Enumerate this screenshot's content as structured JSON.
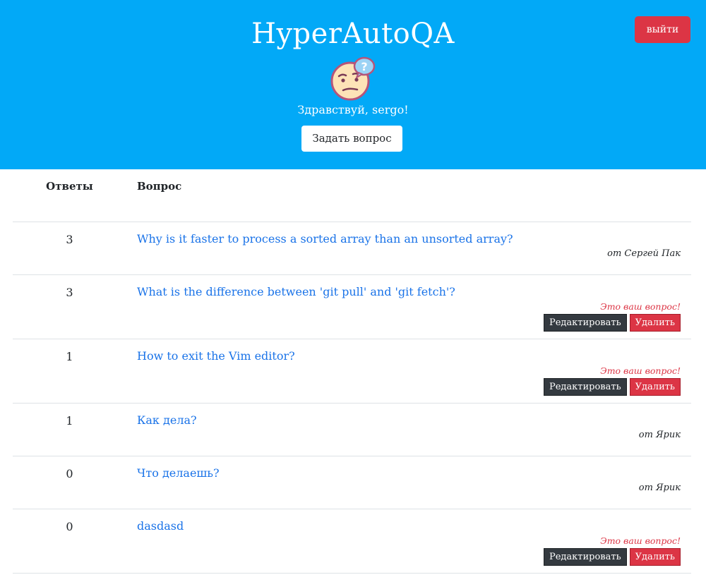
{
  "header": {
    "title": "HyperAutoQA",
    "logout_label": "выйти",
    "greeting": "Здравствуй, sergo!",
    "ask_label": "Задать вопрос",
    "avatar_icon": "confused-face-question-bubble-icon",
    "bg_color": "#02a9f7"
  },
  "table": {
    "col_answers": "Ответы",
    "col_question": "Вопрос",
    "rows": [
      {
        "answers": "3",
        "question": "Why is it faster to process a sorted array than an unsorted array?",
        "author": "от Сергей Пак"
      },
      {
        "answers": "3",
        "question": "What is the difference between 'git pull' and 'git fetch'?",
        "own_note": "Это ваш вопрос!",
        "edit_label": "Редактировать",
        "delete_label": "Удалить"
      },
      {
        "answers": "1",
        "question": "How to exit the Vim editor?",
        "own_note": "Это ваш вопрос!",
        "edit_label": "Редактировать",
        "delete_label": "Удалить"
      },
      {
        "answers": "1",
        "question": "Как дела?",
        "author": "от Ярик"
      },
      {
        "answers": "0",
        "question": "Что делаешь?",
        "author": "от Ярик"
      },
      {
        "answers": "0",
        "question": "dasdasd",
        "own_note": "Это ваш вопрос!",
        "edit_label": "Редактировать",
        "delete_label": "Удалить"
      }
    ]
  },
  "colors": {
    "link": "#1a73e8",
    "danger": "#dc3545",
    "dark": "#343a40"
  }
}
